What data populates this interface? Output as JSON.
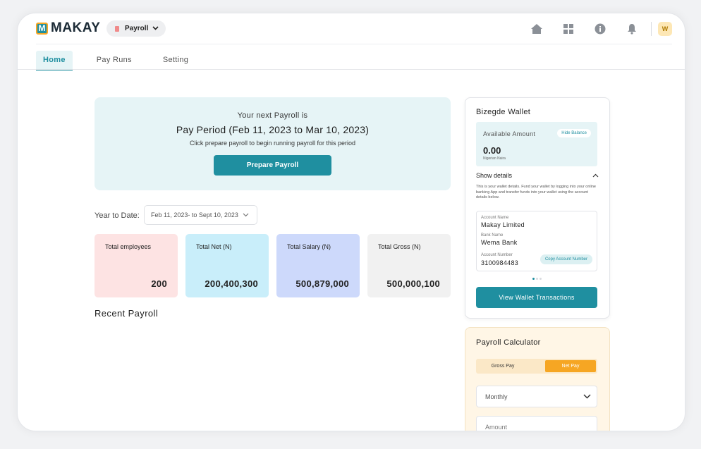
{
  "brand": {
    "logo_letter": "M",
    "name": "MAKAY"
  },
  "product_switcher": {
    "label": "Payroll"
  },
  "top_icons": [
    "home-icon",
    "apps-grid-icon",
    "info-icon",
    "bell-icon"
  ],
  "avatar": {
    "initial": "W"
  },
  "tabs": [
    {
      "label": "Home",
      "active": true
    },
    {
      "label": "Pay Runs",
      "active": false
    },
    {
      "label": "Setting",
      "active": false
    }
  ],
  "banner": {
    "line1": "Your next Payroll is",
    "period": "Pay Period (Feb 11, 2023 to Mar 10, 2023)",
    "hint": "Click prepare payroll to begin running payroll for this period",
    "button": "Prepare Payroll"
  },
  "ytd": {
    "label": "Year to Date:",
    "range": "Feb 11, 2023- to Sept 10, 2023"
  },
  "stats": [
    {
      "title": "Total employees",
      "value": "200",
      "color": "#fde3e3"
    },
    {
      "title": "Total Net (N)",
      "value": "200,400,300",
      "color": "#c9eefa"
    },
    {
      "title": "Total Salary (N)",
      "value": "500,879,000",
      "color": "#cdd9fb"
    },
    {
      "title": "Total Gross (N)",
      "value": "500,000,100",
      "color": "#f1f1f1"
    }
  ],
  "recent_payroll": {
    "title": "Recent  Payroll"
  },
  "wallet": {
    "title": "Bizegde Wallet",
    "available_label": "Available Amount",
    "hide_balance": "Hide Balance",
    "amount": "0.00",
    "currency": "Nigerian Naira",
    "show_details": "Show details",
    "description": "This is your wallet details. Fund your wallet by logging into your online banking App and transfer funds into your wallet using the account details below.",
    "account_name_label": "Account Name",
    "account_name": "Makay Limited",
    "bank_name_label": "Bank Name",
    "bank_name": "Wema Bank",
    "account_number_label": "Account Number",
    "account_number": "3100984483",
    "copy_button": "Copy Account Number",
    "view_transactions": "View Wallet Transactions"
  },
  "calculator": {
    "title": "Payroll Calculator",
    "gross_pay": "Gross Pay",
    "net_pay": "Net Pay",
    "frequency": "Monthly",
    "amount_placeholder": "Amount"
  },
  "colors": {
    "accent": "#1f8fa0",
    "orange": "#f6a623"
  }
}
